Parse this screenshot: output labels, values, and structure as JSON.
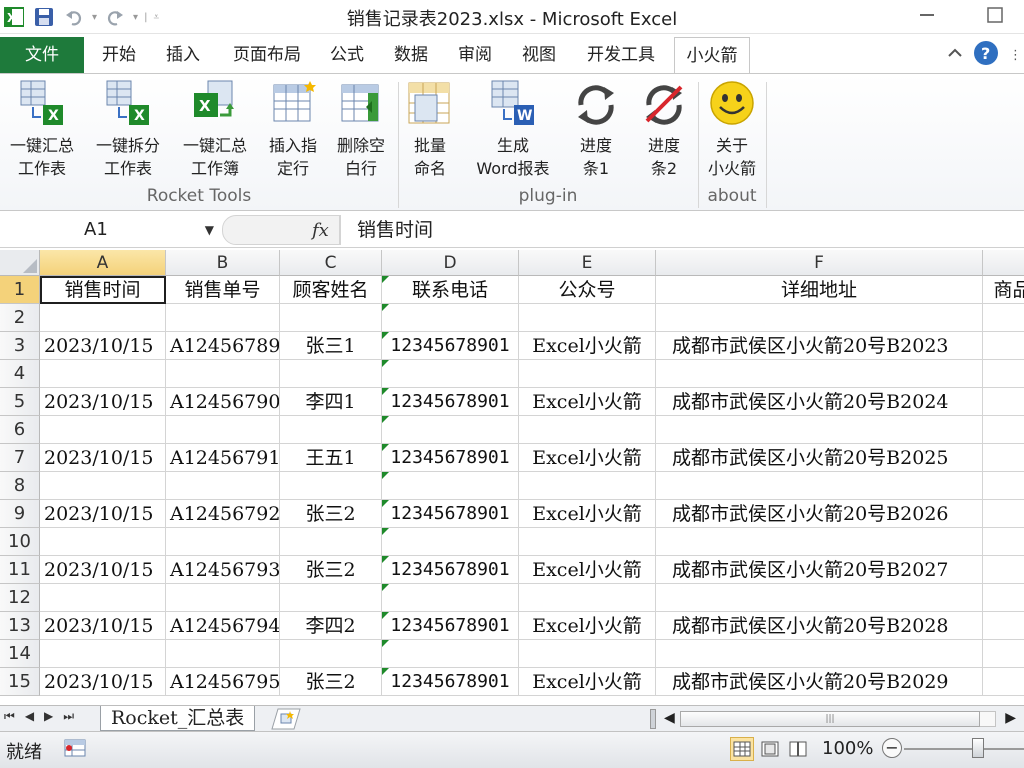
{
  "window": {
    "title": "销售记录表2023.xlsx - Microsoft Excel"
  },
  "ribbon_tabs": [
    {
      "label": "文件"
    },
    {
      "label": "开始"
    },
    {
      "label": "插入"
    },
    {
      "label": "页面布局"
    },
    {
      "label": "公式"
    },
    {
      "label": "数据"
    },
    {
      "label": "审阅"
    },
    {
      "label": "视图"
    },
    {
      "label": "开发工具"
    },
    {
      "label": "小火箭"
    }
  ],
  "ribbon": {
    "buttons": [
      {
        "line1": "一键汇总",
        "line2": "工作表",
        "icon": "merge-sheets-icon"
      },
      {
        "line1": "一键拆分",
        "line2": "工作表",
        "icon": "split-sheets-icon"
      },
      {
        "line1": "一键汇总",
        "line2": "工作簿",
        "icon": "merge-workbooks-icon"
      },
      {
        "line1": "插入指",
        "line2": "定行",
        "icon": "insert-rows-icon"
      },
      {
        "line1": "删除空",
        "line2": "白行",
        "icon": "delete-blank-rows-icon"
      },
      {
        "line1": "批量",
        "line2": "命名",
        "icon": "batch-rename-icon"
      },
      {
        "line1": "生成",
        "line2": "Word报表",
        "icon": "word-report-icon"
      },
      {
        "line1": "进度",
        "line2": "条1",
        "icon": "progress-1-icon"
      },
      {
        "line1": "进度",
        "line2": "条2",
        "icon": "progress-2-icon"
      },
      {
        "line1": "关于",
        "line2": "小火箭",
        "icon": "smiley-icon"
      }
    ],
    "groups": [
      {
        "label": "Rocket Tools"
      },
      {
        "label": "plug-in"
      },
      {
        "label": "about"
      }
    ]
  },
  "formula_bar": {
    "name_box": "A1",
    "fx": "fx",
    "content": "销售时间"
  },
  "columns": [
    "A",
    "B",
    "C",
    "D",
    "E",
    "F"
  ],
  "rows": [
    {
      "num": "1",
      "cells": [
        "销售时间",
        "销售单号",
        "顾客姓名",
        "联系电话",
        "公众号",
        "详细地址",
        "商品"
      ]
    },
    {
      "num": "2",
      "cells": [
        "",
        "",
        "",
        "",
        "",
        "",
        ""
      ]
    },
    {
      "num": "3",
      "cells": [
        "2023/10/15",
        "A12456789",
        "张三1",
        "12345678901",
        "Excel小火箭",
        "成都市武侯区小火箭20号B2023",
        ""
      ]
    },
    {
      "num": "4",
      "cells": [
        "",
        "",
        "",
        "",
        "",
        "",
        ""
      ]
    },
    {
      "num": "5",
      "cells": [
        "2023/10/15",
        "A12456790",
        "李四1",
        "12345678901",
        "Excel小火箭",
        "成都市武侯区小火箭20号B2024",
        ""
      ]
    },
    {
      "num": "6",
      "cells": [
        "",
        "",
        "",
        "",
        "",
        "",
        ""
      ]
    },
    {
      "num": "7",
      "cells": [
        "2023/10/15",
        "A12456791",
        "王五1",
        "12345678901",
        "Excel小火箭",
        "成都市武侯区小火箭20号B2025",
        ""
      ]
    },
    {
      "num": "8",
      "cells": [
        "",
        "",
        "",
        "",
        "",
        "",
        ""
      ]
    },
    {
      "num": "9",
      "cells": [
        "2023/10/15",
        "A12456792",
        "张三2",
        "12345678901",
        "Excel小火箭",
        "成都市武侯区小火箭20号B2026",
        ""
      ]
    },
    {
      "num": "10",
      "cells": [
        "",
        "",
        "",
        "",
        "",
        "",
        ""
      ]
    },
    {
      "num": "11",
      "cells": [
        "2023/10/15",
        "A12456793",
        "张三2",
        "12345678901",
        "Excel小火箭",
        "成都市武侯区小火箭20号B2027",
        ""
      ]
    },
    {
      "num": "12",
      "cells": [
        "",
        "",
        "",
        "",
        "",
        "",
        ""
      ]
    },
    {
      "num": "13",
      "cells": [
        "2023/10/15",
        "A12456794",
        "李四2",
        "12345678901",
        "Excel小火箭",
        "成都市武侯区小火箭20号B2028",
        ""
      ]
    },
    {
      "num": "14",
      "cells": [
        "",
        "",
        "",
        "",
        "",
        "",
        ""
      ]
    },
    {
      "num": "15",
      "cells": [
        "2023/10/15",
        "A12456795",
        "张三2",
        "12345678901",
        "Excel小火箭",
        "成都市武侯区小火箭20号B2029",
        ""
      ]
    }
  ],
  "sheet_tabs": [
    {
      "label": "Rocket_汇总表"
    }
  ],
  "status_bar": {
    "status": "就绪",
    "zoom": "100%"
  },
  "colors": {
    "file_tab": "#1e7a3b",
    "excel_green": "#1f8a2b",
    "selection_header": "#f4d27a",
    "smiley_yellow": "#f6d21a"
  }
}
